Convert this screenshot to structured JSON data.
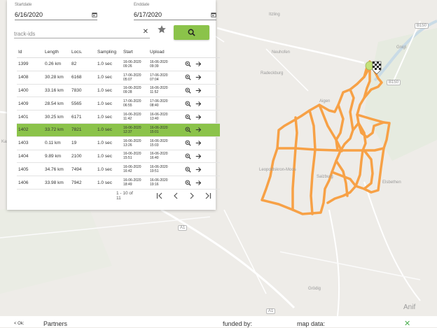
{
  "filters": {
    "startdate_label": "Startdate",
    "startdate_value": "6/16/2020",
    "enddate_label": "Enddate",
    "enddate_value": "6/17/2020",
    "search_placeholder": "track-ids",
    "search_value": "",
    "clear_icon": "close-icon",
    "favorite_icon": "star-icon",
    "search_button_icon": "search-icon"
  },
  "table": {
    "columns": [
      "Id",
      "Length",
      "Locs.",
      "Sampling",
      "Start",
      "Upload"
    ],
    "rows": [
      {
        "id": "1399",
        "length": "0.26 km",
        "locs": "82",
        "sampling": "1.0 sec",
        "start": [
          "16-06-2020",
          "09:26"
        ],
        "upload": [
          "16-06-2020",
          "09:39"
        ]
      },
      {
        "id": "1408",
        "length": "30.28 km",
        "locs": "6168",
        "sampling": "1.0 sec",
        "start": [
          "17-06-2020",
          "05:07"
        ],
        "upload": [
          "17-06-2020",
          "07:04"
        ]
      },
      {
        "id": "1400",
        "length": "33.16 km",
        "locs": "7830",
        "sampling": "1.0 sec",
        "start": [
          "16-06-2020",
          "09:28"
        ],
        "upload": [
          "16-06-2020",
          "11:52"
        ]
      },
      {
        "id": "1409",
        "length": "28.54 km",
        "locs": "5565",
        "sampling": "1.0 sec",
        "start": [
          "17-06-2020",
          "06:55"
        ],
        "upload": [
          "17-06-2020",
          "08:40"
        ]
      },
      {
        "id": "1401",
        "length": "30.25 km",
        "locs": "6171",
        "sampling": "1.0 sec",
        "start": [
          "16-06-2020",
          "11:42"
        ],
        "upload": [
          "16-06-2020",
          "13:40"
        ]
      },
      {
        "id": "1402",
        "length": "33.72 km",
        "locs": "7821",
        "sampling": "1.0 sec",
        "start": [
          "16-06-2020",
          "12:37"
        ],
        "upload": [
          "16-06-2020",
          "15:01"
        ],
        "selected": true
      },
      {
        "id": "1403",
        "length": "0.11 km",
        "locs": "19",
        "sampling": "1.0 sec",
        "start": [
          "16-06-2020",
          "13:26"
        ],
        "upload": [
          "16-06-2020",
          "15:03"
        ]
      },
      {
        "id": "1404",
        "length": "9.89 km",
        "locs": "2100",
        "sampling": "1.0 sec",
        "start": [
          "16-06-2020",
          "15:51"
        ],
        "upload": [
          "16-06-2020",
          "16:40"
        ]
      },
      {
        "id": "1405",
        "length": "34.76 km",
        "locs": "7494",
        "sampling": "1.0 sec",
        "start": [
          "16-06-2020",
          "16:42"
        ],
        "upload": [
          "16-06-2020",
          "19:51"
        ]
      },
      {
        "id": "1406",
        "length": "33.98 km",
        "locs": "7942",
        "sampling": "1.0 sec",
        "start": [
          "16-06-2020",
          "18:49"
        ],
        "upload": [
          "16-06-2020",
          "19:16"
        ]
      }
    ],
    "row_icons": [
      "zoom-in-icon",
      "arrow-right-icon"
    ]
  },
  "pagination": {
    "info": "1 - 10 of 11",
    "icons": [
      "first-page-icon",
      "prev-page-icon",
      "next-page-icon",
      "last-page-icon"
    ]
  },
  "map": {
    "labels": [
      "Itzling",
      "Neuhofen",
      "Gnigl",
      "Aigen",
      "Radeckburg",
      "Leopoldskron-Moos",
      "Anif",
      "Salzburg",
      "Kasern",
      "Elsbethen",
      "Grödig"
    ],
    "road_badges": [
      "B150",
      "B150",
      "A1",
      "A1"
    ],
    "track_color": "#f7a146",
    "start_marker_color": "#c5e17a"
  },
  "footer": {
    "left_text": "< Ok:",
    "partners": "Partners",
    "funded_by": "funded by:",
    "map_data": "map data:",
    "close_icon": "close-icon"
  }
}
